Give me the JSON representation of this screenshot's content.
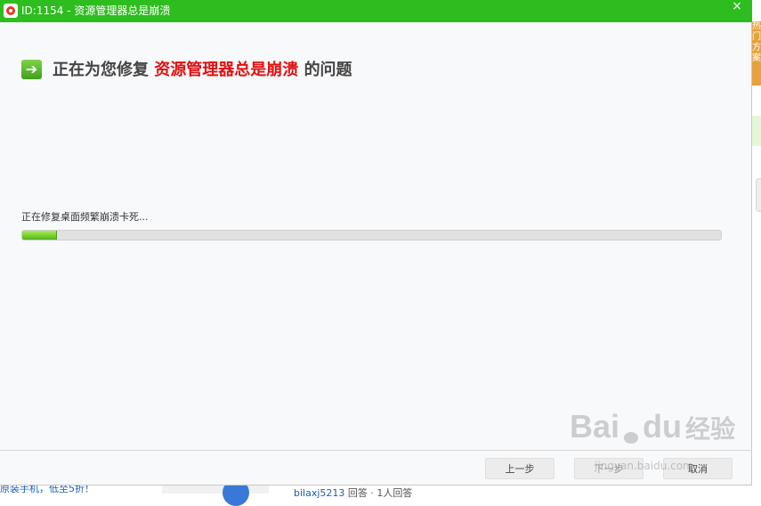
{
  "window": {
    "title": "ID:1154 - 资源管理器总是崩溃",
    "close_glyph": "×"
  },
  "heading": {
    "prefix": "正在为您修复",
    "issue": "资源管理器总是崩溃",
    "suffix": "的问题",
    "icon_glyph": "➔"
  },
  "progress": {
    "status_text": "正在修复桌面频繁崩溃卡死...",
    "percent": 5
  },
  "buttons": {
    "prev": "上一步",
    "next": "下一步",
    "cancel": "取消"
  },
  "background": {
    "side_tab": "热门方案",
    "bottom_left_text": "原装手机，低至5折！",
    "bottom_mid_user": "bilaxj5213",
    "bottom_mid_text": " 回答 · 1人回答"
  },
  "watermark": {
    "logo": "Bai",
    "logo_end": "du",
    "jingyan": "经验",
    "url": "jingyan.baidu.com"
  },
  "colors": {
    "titlebar": "#2ebd1f",
    "issue_text": "#e01010",
    "progress_fill": "#6fcf2b"
  }
}
